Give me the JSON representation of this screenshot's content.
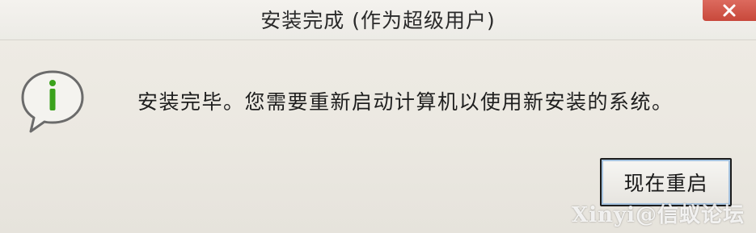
{
  "window": {
    "title": "安装完成 (作为超级用户)"
  },
  "titlebar": {
    "close_icon": "close-icon"
  },
  "dialog": {
    "icon": "info-icon",
    "message": "安装完毕。您需要重新启动计算机以使用新安装的系统。",
    "restart_button": "现在重启"
  },
  "watermark": {
    "text": "Xinyi@信蚁论坛"
  },
  "colors": {
    "close_button": "#d0574a",
    "icon_green": "#3aa21c",
    "button_focus": "#a6c3df"
  }
}
